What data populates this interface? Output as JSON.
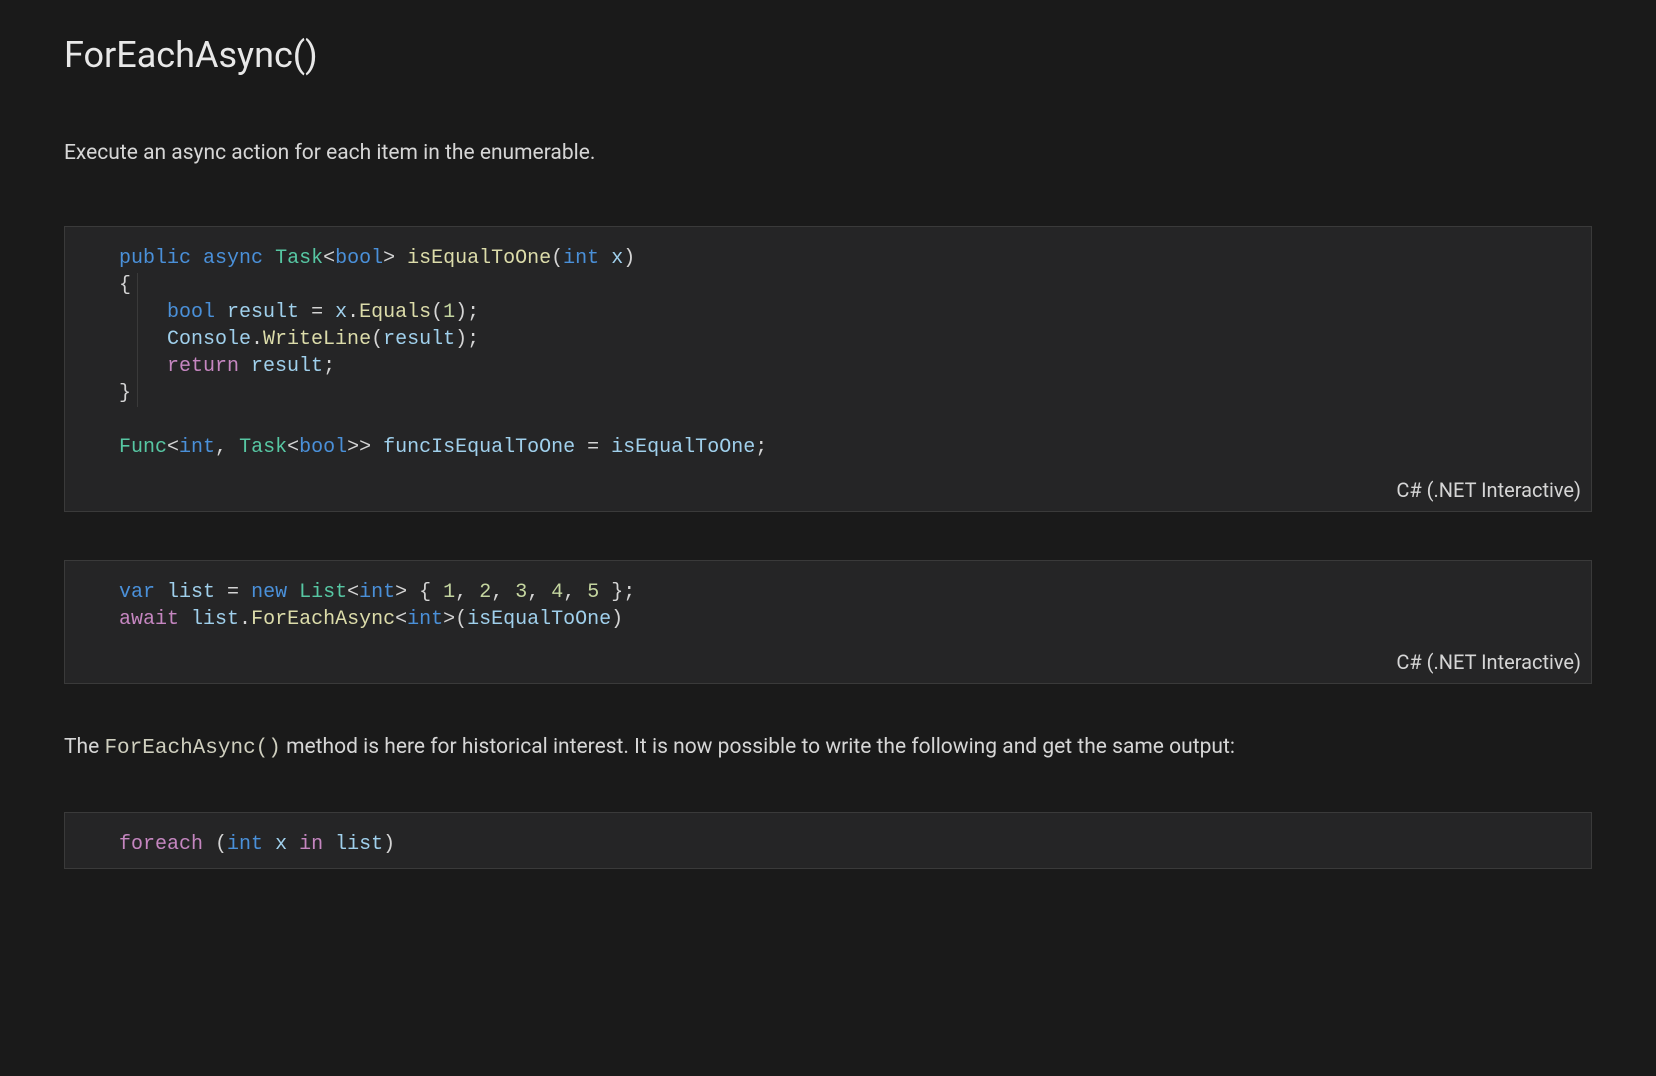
{
  "heading": "ForEachAsync()",
  "intro": "Execute an async action for each item in the enumerable.",
  "lang_label": "C# (.NET Interactive)",
  "cell1": {
    "tokens": [
      [
        [
          "k",
          "public"
        ],
        [
          "c",
          " "
        ],
        [
          "k",
          "async"
        ],
        [
          "c",
          " "
        ],
        [
          "t",
          "Task"
        ],
        [
          "p",
          "<"
        ],
        [
          "k",
          "bool"
        ],
        [
          "p",
          "> "
        ],
        [
          "fn",
          "isEqualToOne"
        ],
        [
          "p",
          "("
        ],
        [
          "k",
          "int"
        ],
        [
          "c",
          " "
        ],
        [
          "v",
          "x"
        ],
        [
          "p",
          ")"
        ]
      ],
      [
        [
          "p",
          "{"
        ]
      ],
      [
        [
          "c",
          "    "
        ],
        [
          "k",
          "bool"
        ],
        [
          "c",
          " "
        ],
        [
          "v",
          "result"
        ],
        [
          "c",
          " = "
        ],
        [
          "v",
          "x"
        ],
        [
          "p",
          "."
        ],
        [
          "fn",
          "Equals"
        ],
        [
          "p",
          "("
        ],
        [
          "n",
          "1"
        ],
        [
          "p",
          ");"
        ]
      ],
      [
        [
          "c",
          "    "
        ],
        [
          "v",
          "Console"
        ],
        [
          "p",
          "."
        ],
        [
          "fn",
          "WriteLine"
        ],
        [
          "p",
          "("
        ],
        [
          "v",
          "result"
        ],
        [
          "p",
          ");"
        ]
      ],
      [
        [
          "c",
          "    "
        ],
        [
          "ctrl",
          "return"
        ],
        [
          "c",
          " "
        ],
        [
          "v",
          "result"
        ],
        [
          "p",
          ";"
        ]
      ],
      [
        [
          "p",
          "}"
        ]
      ],
      [
        [
          "c",
          ""
        ]
      ],
      [
        [
          "t",
          "Func"
        ],
        [
          "p",
          "<"
        ],
        [
          "k",
          "int"
        ],
        [
          "p",
          ", "
        ],
        [
          "t",
          "Task"
        ],
        [
          "p",
          "<"
        ],
        [
          "k",
          "bool"
        ],
        [
          "p",
          ">> "
        ],
        [
          "v",
          "funcIsEqualToOne"
        ],
        [
          "c",
          " = "
        ],
        [
          "v",
          "isEqualToOne"
        ],
        [
          "p",
          ";"
        ]
      ]
    ]
  },
  "cell2": {
    "tokens": [
      [
        [
          "k",
          "var"
        ],
        [
          "c",
          " "
        ],
        [
          "v",
          "list"
        ],
        [
          "c",
          " = "
        ],
        [
          "k",
          "new"
        ],
        [
          "c",
          " "
        ],
        [
          "t",
          "List"
        ],
        [
          "p",
          "<"
        ],
        [
          "k",
          "int"
        ],
        [
          "p",
          "> { "
        ],
        [
          "n",
          "1"
        ],
        [
          "p",
          ", "
        ],
        [
          "n",
          "2"
        ],
        [
          "p",
          ", "
        ],
        [
          "n",
          "3"
        ],
        [
          "p",
          ", "
        ],
        [
          "n",
          "4"
        ],
        [
          "p",
          ", "
        ],
        [
          "n",
          "5"
        ],
        [
          "p",
          " };"
        ]
      ],
      [
        [
          "ctrl",
          "await"
        ],
        [
          "c",
          " "
        ],
        [
          "v",
          "list"
        ],
        [
          "p",
          "."
        ],
        [
          "fn",
          "ForEachAsync"
        ],
        [
          "p",
          "<"
        ],
        [
          "k",
          "int"
        ],
        [
          "p",
          ">("
        ],
        [
          "v",
          "isEqualToOne"
        ],
        [
          "p",
          ")"
        ]
      ]
    ]
  },
  "note": {
    "before": "The ",
    "code": "ForEachAsync()",
    "after": " method is here for historical interest. It is now possible to write the following and get the same output:"
  },
  "cell3": {
    "tokens": [
      [
        [
          "ctrl",
          "foreach"
        ],
        [
          "c",
          " "
        ],
        [
          "p",
          "("
        ],
        [
          "k",
          "int"
        ],
        [
          "c",
          " "
        ],
        [
          "v",
          "x"
        ],
        [
          "c",
          " "
        ],
        [
          "ctrl",
          "in"
        ],
        [
          "c",
          " "
        ],
        [
          "v",
          "list"
        ],
        [
          "p",
          ")"
        ]
      ]
    ]
  }
}
